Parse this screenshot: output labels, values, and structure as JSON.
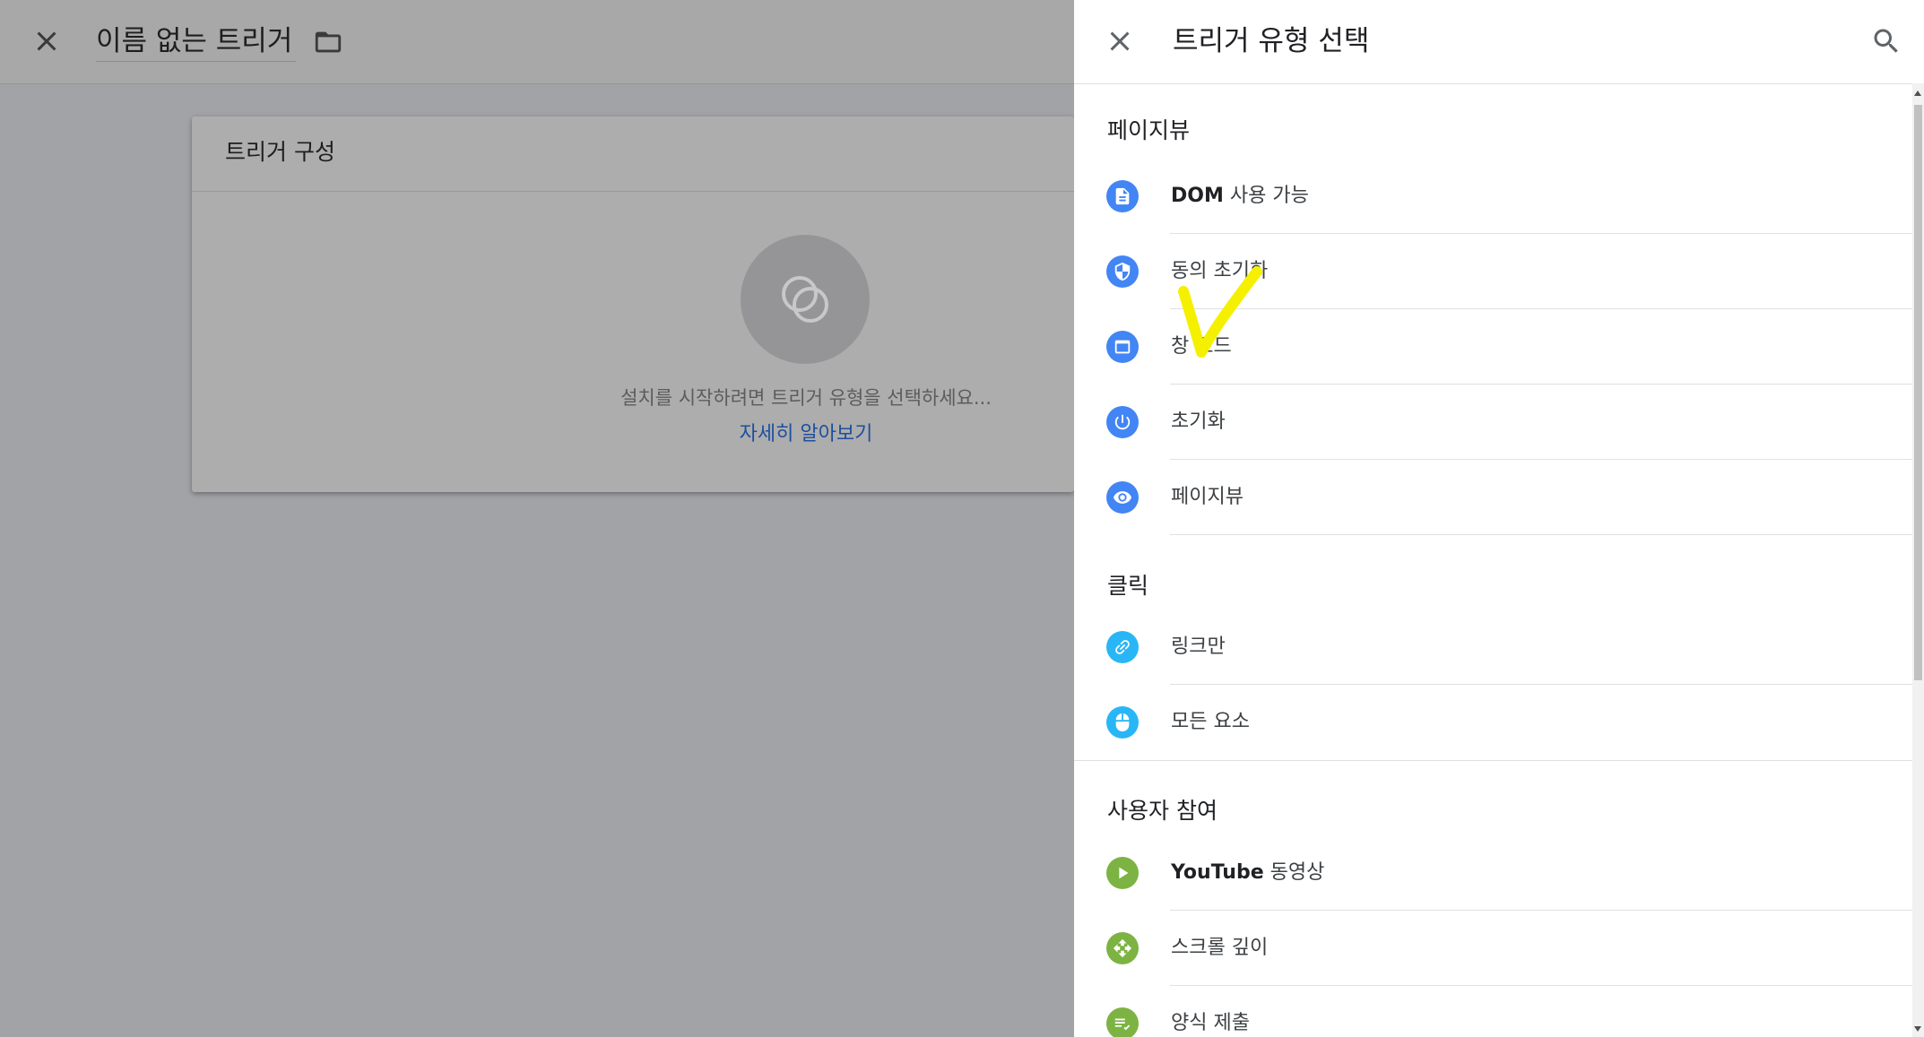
{
  "editor": {
    "title": "이름 없는 트리거",
    "config_title": "트리거 구성",
    "empty_message": "설치를 시작하려면 트리거 유형을 선택하세요...",
    "learn_more": "자세히 알아보기"
  },
  "panel": {
    "title": "트리거 유형 선택",
    "sections": [
      {
        "title": "페이지뷰",
        "items": [
          {
            "bold": "DOM",
            "label": " 사용 가능",
            "icon": "document-icon",
            "color": "#4285f4"
          },
          {
            "bold": "",
            "label": "동의 초기화",
            "icon": "shield-icon",
            "color": "#4285f4"
          },
          {
            "bold": "",
            "label": "창 로드",
            "icon": "window-icon",
            "color": "#4285f4"
          },
          {
            "bold": "",
            "label": "초기화",
            "icon": "power-icon",
            "color": "#4285f4"
          },
          {
            "bold": "",
            "label": "페이지뷰",
            "icon": "eye-icon",
            "color": "#4285f4"
          }
        ]
      },
      {
        "title": "클릭",
        "items": [
          {
            "bold": "",
            "label": "링크만",
            "icon": "link-icon",
            "color": "#29b6f6"
          },
          {
            "bold": "",
            "label": "모든 요소",
            "icon": "mouse-icon",
            "color": "#29b6f6"
          }
        ]
      },
      {
        "title": "사용자 참여",
        "items": [
          {
            "bold": "YouTube",
            "label": " 동영상",
            "icon": "play-icon",
            "color": "#7cb342"
          },
          {
            "bold": "",
            "label": "스크롤 깊이",
            "icon": "move-icon",
            "color": "#7cb342"
          },
          {
            "bold": "",
            "label": "양식 제출",
            "icon": "form-check-icon",
            "color": "#7cb342"
          }
        ]
      }
    ]
  }
}
